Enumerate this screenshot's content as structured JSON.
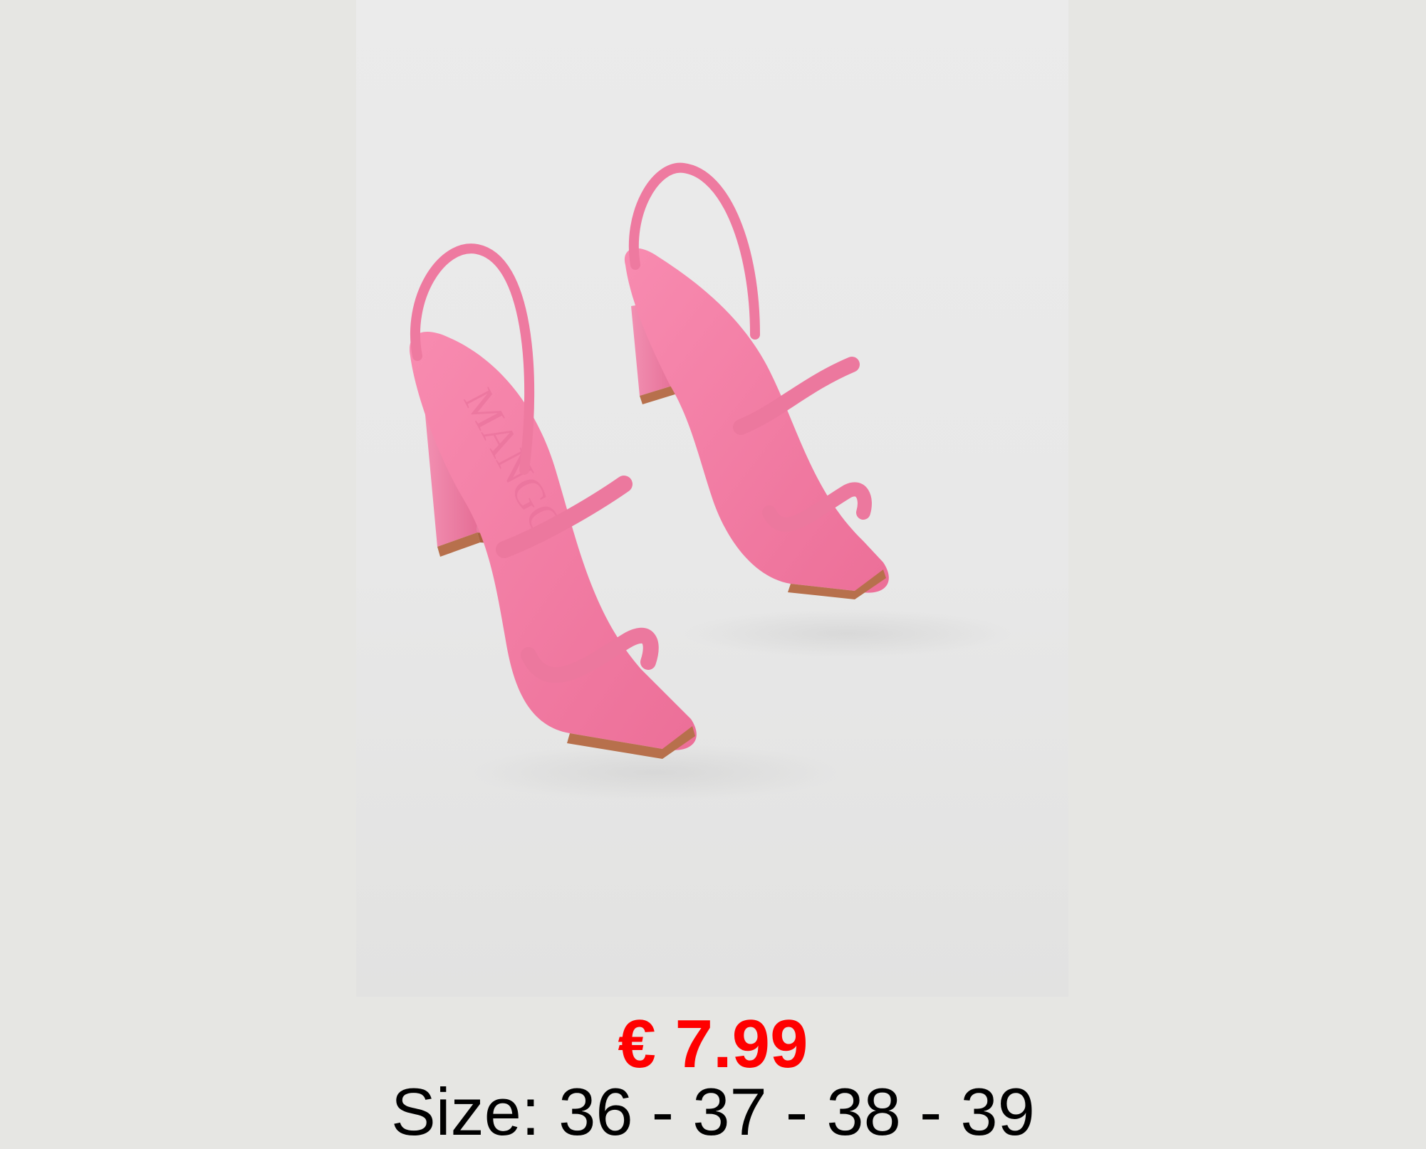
{
  "product": {
    "image_alt": "Pink square-toe slingback heeled sandals",
    "brand_emboss": "MANGO",
    "price": "€ 7.99",
    "size_line": "Size: 36 - 37 - 38 - 39"
  },
  "colors": {
    "page_background": "#e6e6e3",
    "price": "#ff0000",
    "size_text": "#000000",
    "sandal_pink": "#f07aa0",
    "sole_brown": "#b7704c"
  },
  "icons": {
    "product_photo": "pink-sandals-image"
  }
}
